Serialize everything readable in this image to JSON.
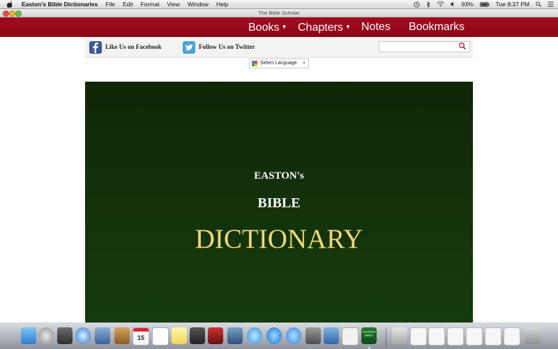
{
  "menubar": {
    "app_name": "Easton's Bible Dictionaries",
    "items": [
      "File",
      "Edit",
      "Format",
      "View",
      "Window",
      "Help"
    ],
    "battery": "93%",
    "clock": "Tue 8:37 PM"
  },
  "window": {
    "title": "The Bible Scholar"
  },
  "nav": {
    "books": "Books",
    "chapters": "Chapters",
    "notes": "Notes",
    "bookmarks": "Bookmarks"
  },
  "social": {
    "facebook": "Like Us on Facebook",
    "twitter": "Follow Us on Twitter",
    "search_placeholder": ""
  },
  "translate": {
    "label": "Select Language"
  },
  "banner": {
    "line1": "EASTON's",
    "line2": "BIBLE",
    "line3": "DICTIONARY"
  },
  "dock": {
    "calendar_day": "15",
    "app_label": "EASTON'S BIBLE"
  },
  "colors": {
    "nav_bg": "#9b0b1c",
    "banner_bg": "#13330b",
    "dictionary_gold": "#f0d77a"
  }
}
